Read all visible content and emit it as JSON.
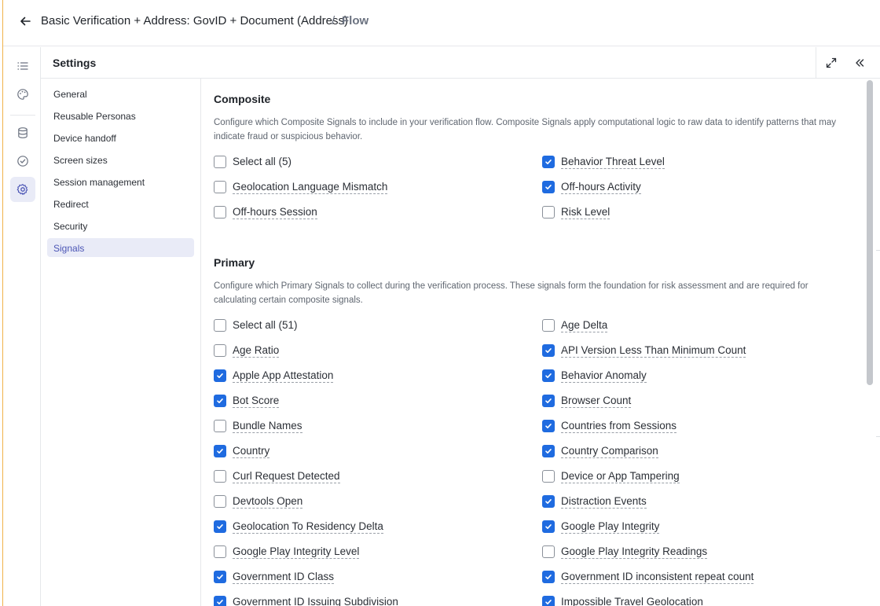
{
  "breadcrumb": {
    "title": "Basic Verification + Address: GovID + Document (Address)",
    "separator": "/",
    "current": "Flow"
  },
  "rail": {
    "items": [
      {
        "icon": "list-icon"
      },
      {
        "icon": "palette-icon"
      },
      {
        "icon": "database-icon"
      },
      {
        "icon": "check-circle-icon"
      },
      {
        "icon": "gear-icon",
        "active": true
      }
    ]
  },
  "settings": {
    "title": "Settings",
    "nav": [
      {
        "label": "General"
      },
      {
        "label": "Reusable Personas"
      },
      {
        "label": "Device handoff"
      },
      {
        "label": "Screen sizes"
      },
      {
        "label": "Session management"
      },
      {
        "label": "Redirect"
      },
      {
        "label": "Security"
      },
      {
        "label": "Signals",
        "active": true
      }
    ]
  },
  "composite": {
    "title": "Composite",
    "description": "Configure which Composite Signals to include in your verification flow. Composite Signals apply computational logic to raw data to identify patterns that may indicate fraud or suspicious behavior.",
    "select_all": {
      "label": "Select all (5)",
      "checked": false
    },
    "left": [
      {
        "label": "Geolocation Language Mismatch",
        "checked": false
      },
      {
        "label": "Off-hours Session",
        "checked": false
      }
    ],
    "right": [
      {
        "label": "Behavior Threat Level",
        "checked": true
      },
      {
        "label": "Off-hours Activity",
        "checked": true
      },
      {
        "label": "Risk Level",
        "checked": false
      }
    ]
  },
  "primary": {
    "title": "Primary",
    "description": "Configure which Primary Signals to collect during the verification process. These signals form the foundation for risk assessment and are required for calculating certain composite signals.",
    "select_all": {
      "label": "Select all (51)",
      "checked": false
    },
    "left": [
      {
        "label": "Age Ratio",
        "checked": false
      },
      {
        "label": "Apple App Attestation",
        "checked": true
      },
      {
        "label": "Bot Score",
        "checked": true
      },
      {
        "label": "Bundle Names",
        "checked": false
      },
      {
        "label": "Country",
        "checked": true
      },
      {
        "label": "Curl Request Detected",
        "checked": false
      },
      {
        "label": "Devtools Open",
        "checked": false
      },
      {
        "label": "Geolocation To Residency Delta",
        "checked": true
      },
      {
        "label": "Google Play Integrity Level",
        "checked": false
      },
      {
        "label": "Government ID Class",
        "checked": true
      },
      {
        "label": "Government ID Issuing Subdivision",
        "checked": true
      }
    ],
    "right": [
      {
        "label": "Age Delta",
        "checked": false
      },
      {
        "label": "API Version Less Than Minimum Count",
        "checked": true
      },
      {
        "label": "Behavior Anomaly",
        "checked": true
      },
      {
        "label": "Browser Count",
        "checked": true
      },
      {
        "label": "Countries from Sessions",
        "checked": true
      },
      {
        "label": "Country Comparison",
        "checked": true
      },
      {
        "label": "Device or App Tampering",
        "checked": false
      },
      {
        "label": "Distraction Events",
        "checked": true
      },
      {
        "label": "Google Play Integrity",
        "checked": true
      },
      {
        "label": "Google Play Integrity Readings",
        "checked": false
      },
      {
        "label": "Government ID inconsistent repeat count",
        "checked": true
      },
      {
        "label": "Impossible Travel Geolocation",
        "checked": true
      }
    ]
  },
  "colors": {
    "accent": "#1f6be0",
    "nav_active_bg": "#e9ebf7",
    "nav_active_text": "#4b55b5",
    "window_edge": "#f0b24a"
  }
}
